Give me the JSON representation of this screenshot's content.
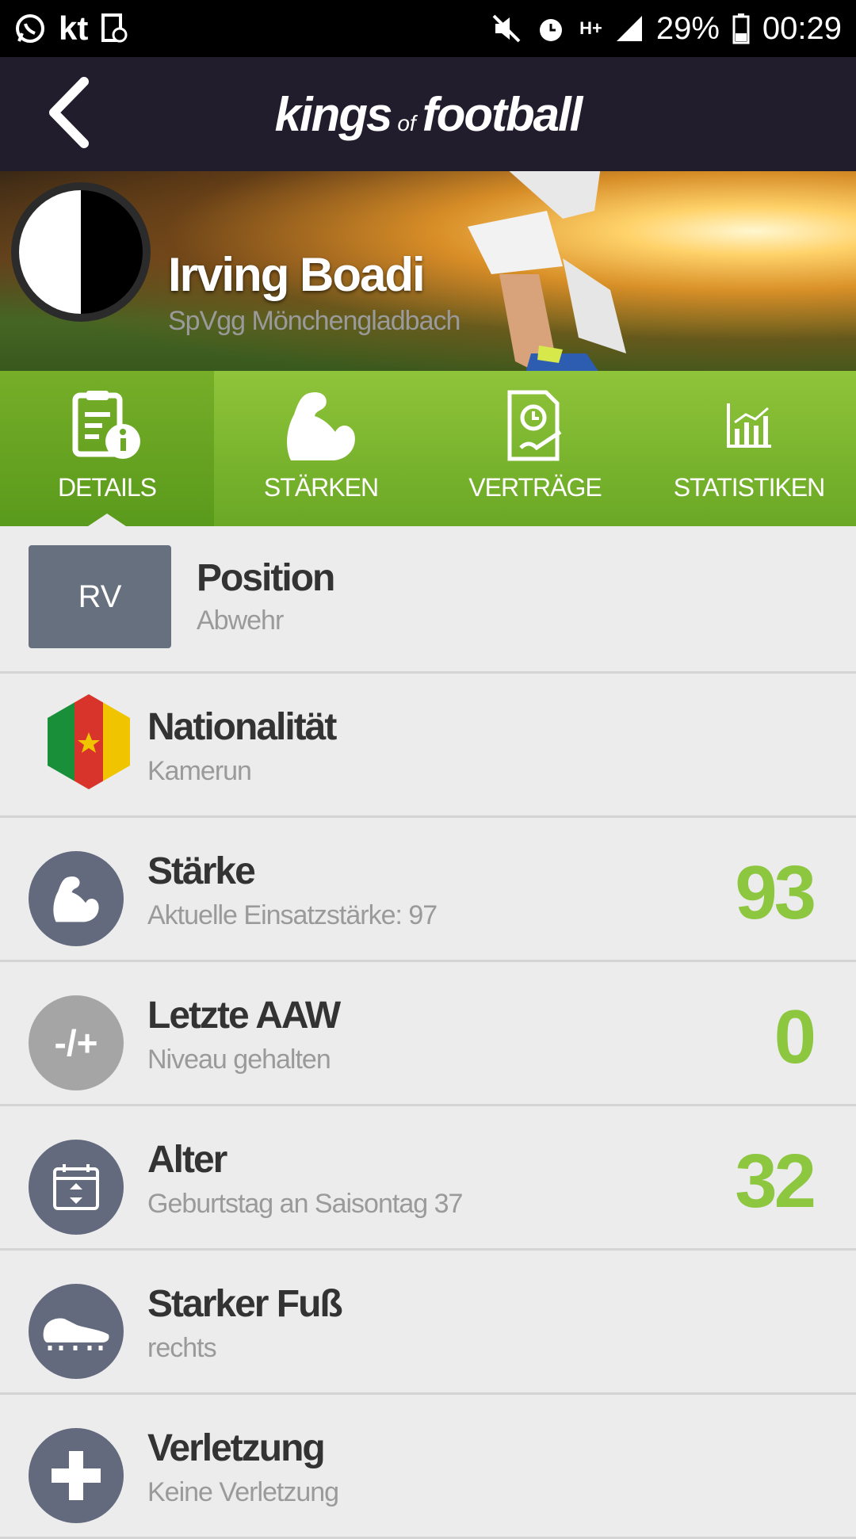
{
  "status": {
    "carrier": "kt",
    "network": "H+",
    "battery": "29%",
    "time": "00:29"
  },
  "header": {
    "logo_main1": "kings",
    "logo_of": "of",
    "logo_main2": "football"
  },
  "player": {
    "name": "Irving Boadi",
    "club": "SpVgg Mönchengladbach"
  },
  "tabs": [
    {
      "label": "DETAILS",
      "icon": "details-icon",
      "active": true
    },
    {
      "label": "STÄRKEN",
      "icon": "muscle-icon"
    },
    {
      "label": "VERTRÄGE",
      "icon": "contract-icon"
    },
    {
      "label": "STATISTIKEN",
      "icon": "stats-icon"
    }
  ],
  "details": {
    "position": {
      "badge": "RV",
      "title": "Position",
      "sub": "Abwehr"
    },
    "nationality": {
      "title": "Nationalität",
      "sub": "Kamerun"
    },
    "strength": {
      "title": "Stärke",
      "sub": "Aktuelle Einsatzstärke: 97",
      "value": "93"
    },
    "aaw": {
      "icon_text": "-/+",
      "title": "Letzte AAW",
      "sub": "Niveau gehalten",
      "value": "0"
    },
    "age": {
      "title": "Alter",
      "sub": "Geburtstag an Saisontag 37",
      "value": "32"
    },
    "foot": {
      "title": "Starker Fuß",
      "sub": "rechts"
    },
    "injury": {
      "title": "Verletzung",
      "sub": "Keine Verletzung"
    }
  },
  "colors": {
    "accent": "#8dc63f",
    "header": "#221d2c",
    "icon_circle": "#636a7d"
  }
}
